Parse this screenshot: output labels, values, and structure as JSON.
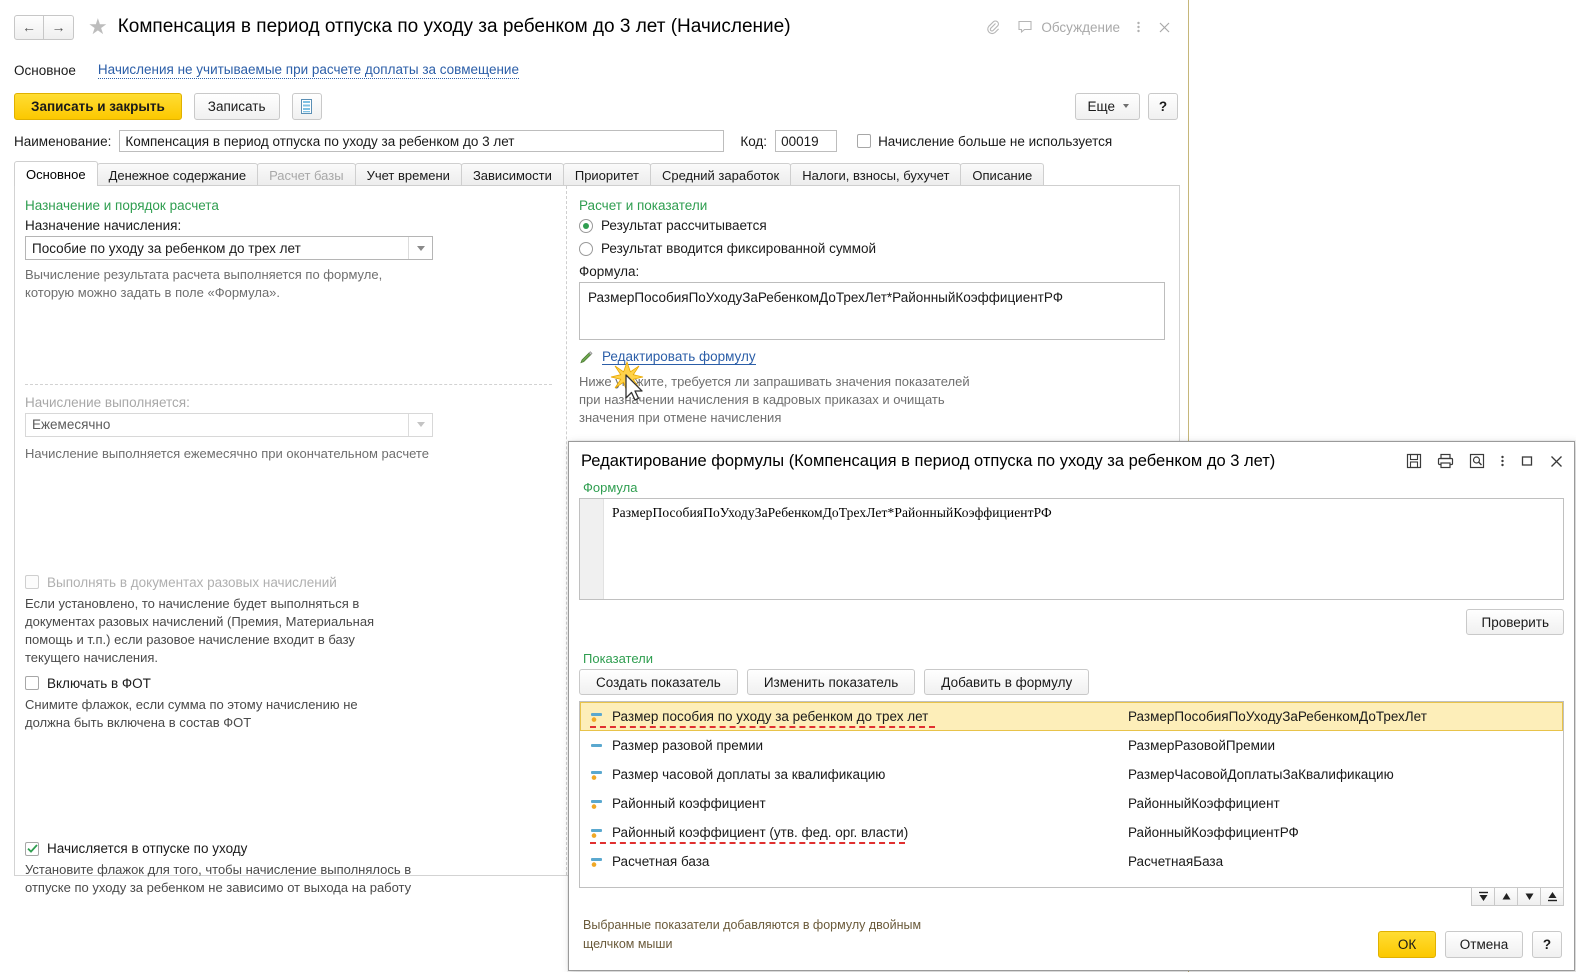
{
  "window": {
    "title": "Компенсация в период отпуска по уходу за ребенком до 3 лет (Начисление)",
    "nav_back_icon": "arrow-left-icon",
    "nav_forward_icon": "arrow-right-icon",
    "favorite_icon": "star-icon",
    "attach_icon": "paperclip-icon",
    "discussion_icon": "chat-bubble-icon",
    "discussion_label": "Обсуждение",
    "more_menu_icon": "kebab-menu-icon",
    "close_icon": "close-icon"
  },
  "navstrip": {
    "current": "Основное",
    "link": "Начисления не учитываемые при расчете доплаты за совмещение"
  },
  "toolbar": {
    "save_close_label": "Записать и закрыть",
    "save_label": "Записать",
    "print_icon": "report-icon",
    "more_label": "Еще",
    "help_label": "?"
  },
  "name_row": {
    "name_label": "Наименование:",
    "name_value": "Компенсация в период отпуска по уходу за ребенком до 3 лет",
    "code_label": "Код:",
    "code_value": "00019",
    "unused_checkbox_label": "Начисление больше не используется",
    "unused_checked": false
  },
  "tabs": [
    {
      "label": "Основное",
      "state": "active"
    },
    {
      "label": "Денежное содержание",
      "state": "normal"
    },
    {
      "label": "Расчет базы",
      "state": "disabled"
    },
    {
      "label": "Учет времени",
      "state": "normal"
    },
    {
      "label": "Зависимости",
      "state": "normal"
    },
    {
      "label": "Приоритет",
      "state": "normal"
    },
    {
      "label": "Средний заработок",
      "state": "normal"
    },
    {
      "label": "Налоги, взносы, бухучет",
      "state": "normal"
    },
    {
      "label": "Описание",
      "state": "normal"
    }
  ],
  "left_panel": {
    "group_title": "Назначение и порядок расчета",
    "purpose_label": "Назначение начисления:",
    "purpose_value": "Пособие по уходу за ребенком до трех лет",
    "purpose_hint_line1": "Вычисление результата расчета выполняется по формуле,",
    "purpose_hint_line2": "которую можно задать в поле «Формула».",
    "performed_label": "Начисление выполняется:",
    "performed_value": "Ежемесячно",
    "performed_hint": "Начисление выполняется ежемесячно при окончательном расчете",
    "onetime_checkbox_label": "Выполнять в документах разовых начислений",
    "onetime_checked": false,
    "onetime_hint_line1": "Если установлено, то начисление будет выполняться в",
    "onetime_hint_line2": "документах разовых начислений (Премия, Материальная",
    "onetime_hint_line3": "помощь и т.п.) если разовое начисление входит в базу",
    "onetime_hint_line4": "текущего начисления.",
    "fot_checkbox_label": "Включать в ФОТ",
    "fot_checked": false,
    "fot_hint_line1": "Снимите флажок, если сумма по этому начислению не",
    "fot_hint_line2": "должна быть включена в состав ФОТ",
    "careleave_checkbox_label": "Начисляется в отпуске по уходу",
    "careleave_checked": true,
    "careleave_hint_line1": "Установите флажок для того, чтобы начисление выполнялось в",
    "careleave_hint_line2": "отпуске по уходу за ребенком не зависимо от выхода на работу"
  },
  "right_panel": {
    "group_title": "Расчет и показатели",
    "radio_calculated_label": "Результат рассчитывается",
    "radio_fixed_label": "Результат вводится фиксированной суммой",
    "radio_selected": "calculated",
    "formula_label": "Формула:",
    "formula_value": "РазмерПособияПоУходуЗаРебенкомДоТрехЛет*РайонныйКоэффициентРФ",
    "edit_formula_link": "Редактировать формулу",
    "edit_formula_icon": "pencil-icon",
    "hint_line1": "Ниже укажите, требуется ли запрашивать значения показателей",
    "hint_line2": "при назначении начисления в кадровых приказах и очищать",
    "hint_line3": "значения при отмене начисления"
  },
  "dialog": {
    "title": "Редактирование формулы (Компенсация в период отпуска по уходу за ребенком до 3 лет)",
    "icons": [
      "save-icon",
      "print-icon",
      "print-preview-icon",
      "kebab-menu-icon",
      "maximize-icon",
      "close-icon"
    ],
    "formula_group_label": "Формула",
    "formula_text": "РазмерПособияПоУходуЗаРебенкомДоТрехЛет*РайонныйКоэффициентРФ",
    "check_button_label": "Проверить",
    "indicators_group_label": "Показатели",
    "create_indicator_label": "Создать показатель",
    "edit_indicator_label": "Изменить показатель",
    "add_to_formula_label": "Добавить в формулу",
    "indicators": [
      {
        "name": "Размер пособия по уходу за ребенком до трех лет",
        "code": "РазмерПособияПоУходуЗаРебенкомДоТрехЛет",
        "icon": "indicator-value-icon",
        "selected": true,
        "underlined": true,
        "underline_width": 345
      },
      {
        "name": "Размер разовой премии",
        "code": "РазмерРазовойПремии",
        "icon": "indicator-plain-icon",
        "selected": false,
        "underlined": false,
        "underline_width": 0
      },
      {
        "name": "Размер часовой доплаты за квалификацию",
        "code": "РазмерЧасовойДоплатыЗаКвалификацию",
        "icon": "indicator-value-icon",
        "selected": false,
        "underlined": false,
        "underline_width": 0
      },
      {
        "name": "Районный коэффициент",
        "code": "РайонныйКоэффициент",
        "icon": "indicator-value-icon",
        "selected": false,
        "underlined": false,
        "underline_width": 0
      },
      {
        "name": "Районный коэффициент (утв. фед. орг. власти)",
        "code": "РайонныйКоэффициентРФ",
        "icon": "indicator-value-icon",
        "selected": false,
        "underlined": true,
        "underline_width": 315
      },
      {
        "name": "Расчетная база",
        "code": "РасчетнаяБаза",
        "icon": "indicator-value-icon",
        "selected": false,
        "underlined": false,
        "underline_width": 0
      }
    ],
    "sort_buttons": [
      "move-to-top-icon",
      "move-up-icon",
      "move-down-icon",
      "move-to-bottom-icon"
    ],
    "footer_note_line1": "Выбранные показатели добавляются в формулу двойным",
    "footer_note_line2": "щелчком мыши",
    "ok_label": "ОК",
    "cancel_label": "Отмена",
    "help_label": "?"
  },
  "colors": {
    "accent_yellow": "#fcc800",
    "group_green": "#2f9e50",
    "link_blue": "#2b5ea8",
    "selection_bg": "#fdeeb9",
    "selection_border": "#e8c34a",
    "underline_red": "#e03030"
  }
}
